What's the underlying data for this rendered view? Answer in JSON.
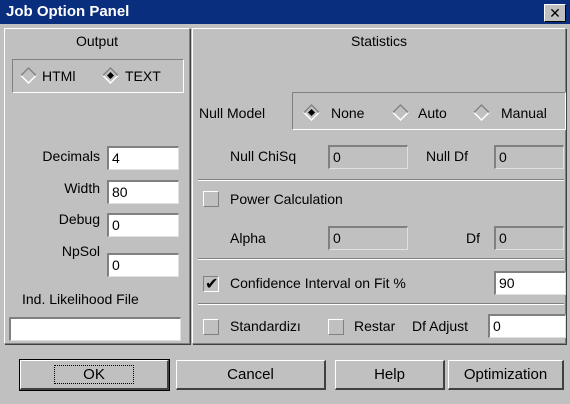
{
  "window": {
    "title": "Job Option Panel",
    "close_label": "✕"
  },
  "output": {
    "header": "Output",
    "format": {
      "html_label": "HTMl",
      "text_label": "TEXT",
      "selected": "TEXT"
    },
    "decimals": {
      "label": "Decimals",
      "value": "4"
    },
    "width": {
      "label": "Width",
      "value": "80"
    },
    "debug": {
      "label": "Debug",
      "value": "0"
    },
    "npsol": {
      "label": "NpSol",
      "value": "0"
    },
    "likelihood": {
      "label": "Ind. Likelihood File",
      "value": ""
    }
  },
  "statistics": {
    "header": "Statistics",
    "null_model": {
      "label": "Null Model",
      "none_label": "None",
      "auto_label": "Auto",
      "manual_label": "Manual",
      "selected": "None"
    },
    "null_chisq": {
      "label": "Null ChiSq",
      "value": "0"
    },
    "null_df": {
      "label": "Null Df",
      "value": "0"
    },
    "power": {
      "label": "Power Calculation",
      "checked": false
    },
    "alpha": {
      "label": "Alpha",
      "value": "0"
    },
    "df": {
      "label": "Df",
      "value": "0"
    },
    "confidence": {
      "label": "Confidence Interval on Fit %",
      "checked": true,
      "value": "90"
    },
    "standardize": {
      "label": "Standardizı",
      "checked": false
    },
    "restart": {
      "label": "Restar",
      "checked": false
    },
    "df_adjust": {
      "label": "Df Adjust",
      "value": "0"
    }
  },
  "buttons": {
    "ok": "OK",
    "cancel": "Cancel",
    "help": "Help",
    "optimization": "Optimization"
  }
}
